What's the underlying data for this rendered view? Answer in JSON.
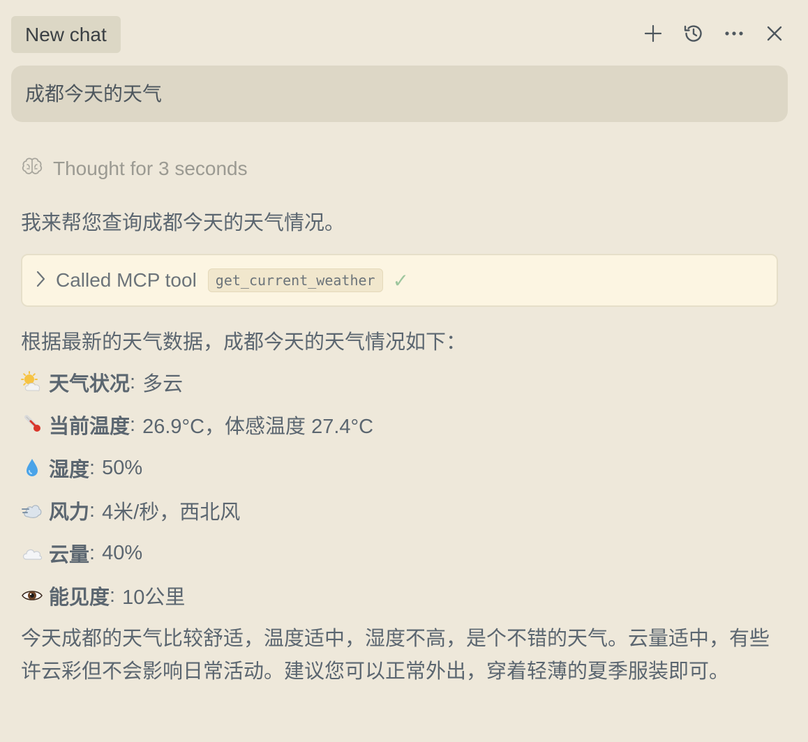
{
  "header": {
    "tab_title": "New chat",
    "actions": [
      {
        "name": "new-chat-icon"
      },
      {
        "name": "history-icon"
      },
      {
        "name": "more-icon"
      },
      {
        "name": "close-icon"
      }
    ]
  },
  "user_message": "成都今天的天气",
  "assistant": {
    "thought": "Thought for 3 seconds",
    "intro": "我来帮您查询成都今天的天气情况。",
    "tool_call": {
      "label": "Called MCP tool",
      "tool_name": "get_current_weather",
      "status": "✓"
    },
    "lead": "根据最新的天气数据，成都今天的天气情况如下：",
    "weather_items": [
      {
        "icon": "sun-behind-cloud-icon",
        "key": "天气状况",
        "value": "多云"
      },
      {
        "icon": "thermometer-icon",
        "key": "当前温度",
        "value": "26.9°C，体感温度 27.4°C"
      },
      {
        "icon": "droplet-icon",
        "key": "湿度",
        "value": "50%"
      },
      {
        "icon": "wind-icon",
        "key": "风力",
        "value": "4米/秒，西北风"
      },
      {
        "icon": "cloud-icon",
        "key": "云量",
        "value": "40%"
      },
      {
        "icon": "eye-icon",
        "key": "能见度",
        "value": "10公里"
      }
    ],
    "summary": "今天成都的天气比较舒适，温度适中，湿度不高，是个不错的天气。云量适中，有些许云彩但不会影响日常活动。建议您可以正常外出，穿着轻薄的夏季服装即可。"
  },
  "colors": {
    "background": "#EEE8DA",
    "user_bubble": "#DDD7C6",
    "tool_box": "#FCF5E2",
    "text": "#5B6670",
    "muted": "#9B9A92",
    "check": "#9EC69E"
  }
}
